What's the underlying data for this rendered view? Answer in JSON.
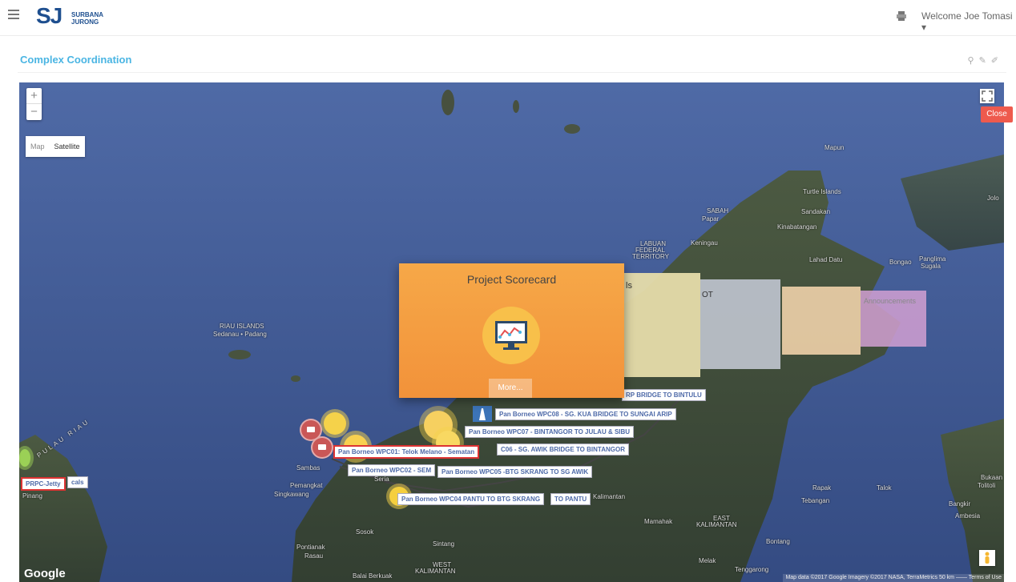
{
  "header": {
    "brand_mark": "SJ",
    "brand_line1": "SURBANA",
    "brand_line2": "JURONG",
    "welcome": "Welcome Joe Tomasi ▾"
  },
  "page": {
    "title": "Complex Coordination"
  },
  "map": {
    "zoom_in": "+",
    "zoom_out": "−",
    "type_map": "Map",
    "type_satellite": "Satellite",
    "close_label": "Close",
    "attribution_logo": "Google",
    "footer_text": "Map data ©2017 Google Imagery ©2017 NASA, TerraMetrics   50 km ⎯⎯⎯⎯   Terms of Use",
    "place_labels": [
      {
        "text": "Mapun"
      },
      {
        "text": "Turtle Islands"
      },
      {
        "text": "Jolo"
      },
      {
        "text": "SABAH"
      },
      {
        "text": "Papar"
      },
      {
        "text": "Sandakan"
      },
      {
        "text": "Kinabatangan"
      },
      {
        "text": "Keningau"
      },
      {
        "text": "LABUAN"
      },
      {
        "text": "FEDERAL"
      },
      {
        "text": "TERRITORY"
      },
      {
        "text": "Lahad Datu"
      },
      {
        "text": "Bongao"
      },
      {
        "text": "Panglima"
      },
      {
        "text": "Sugala"
      },
      {
        "text": "RIAU ISLANDS"
      },
      {
        "text": "Sedanau • Padang"
      },
      {
        "text": "Sambas"
      },
      {
        "text": "Pemangkat"
      },
      {
        "text": "Singkawang"
      },
      {
        "text": "Seria"
      },
      {
        "text": "Sosok"
      },
      {
        "text": "Pontianak"
      },
      {
        "text": "Rasau"
      },
      {
        "text": "Sintang"
      },
      {
        "text": "WEST"
      },
      {
        "text": "KALIMANTAN"
      },
      {
        "text": "Balai Berkuak"
      },
      {
        "text": "Kalimantan"
      },
      {
        "text": "Mamahak"
      },
      {
        "text": "EAST"
      },
      {
        "text": "KALIMANTAN"
      },
      {
        "text": "Bontang"
      },
      {
        "text": "Rapak"
      },
      {
        "text": "Talok"
      },
      {
        "text": "Tebangan"
      },
      {
        "text": "Bangkir"
      },
      {
        "text": "Ambesia"
      },
      {
        "text": "Tolitoli"
      },
      {
        "text": "Bukaan"
      },
      {
        "text": "Melak"
      },
      {
        "text": "Tenggarong"
      },
      {
        "text": "Pinang"
      },
      {
        "text": "PULAU RIAU"
      }
    ],
    "projects": [
      {
        "label": "Pan Borneo WPC08 - SG. KUA BRIDGE TO SUNGAI ARIP"
      },
      {
        "label": "Pan Borneo WPC07 - BINTANGOR TO JULAU & SIBU"
      },
      {
        "label": "C06 - SG. AWIK BRIDGE TO BINTANGOR"
      },
      {
        "label": "Pan Borneo WPC01: Telok Melano - Sematan"
      },
      {
        "label": "Pan Borneo WPC02 - SEM"
      },
      {
        "label": "Pan Borneo WPC05 -BTG SKRANG TO SG AWIK"
      },
      {
        "label": "Pan Borneo WPC04 PANTU TO BTG SKRANG"
      },
      {
        "label": "TO PANTU"
      },
      {
        "label": "PRPC-Jetty"
      },
      {
        "label": "cals"
      },
      {
        "label": "RP BRIDGE TO BINTULU"
      }
    ]
  },
  "carousel": {
    "active_title": "Project Scorecard",
    "more_label": "More...",
    "peek_texts": [
      "ls",
      "OT",
      "Announcements"
    ]
  },
  "colors": {
    "accent": "#4ab5e3",
    "close": "#ee5a4d",
    "card": "#f4a040"
  }
}
